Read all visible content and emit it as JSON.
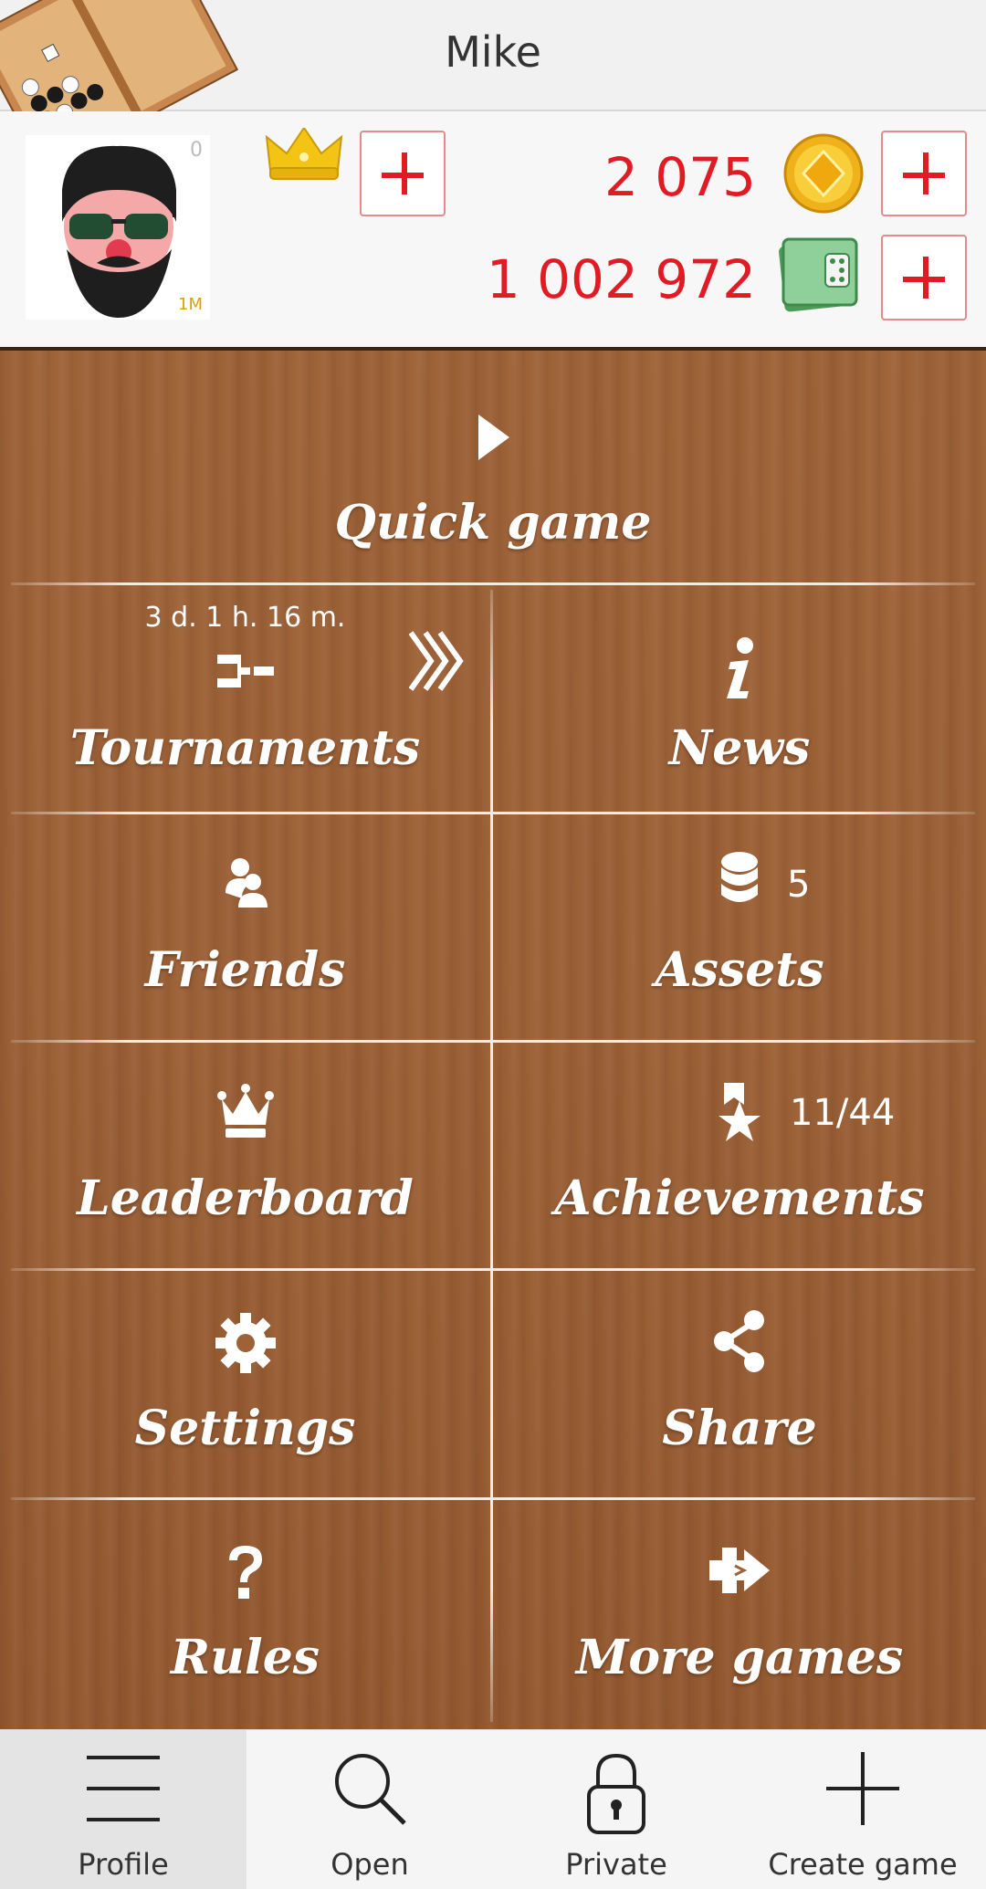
{
  "header": {
    "title": "Mike"
  },
  "profile": {
    "level": "0",
    "badge": "1M",
    "coins": "2 075",
    "cash": "1 002 972"
  },
  "menu": {
    "quick_game": "Quick game",
    "tournaments": {
      "label": "Tournaments",
      "timer": "3 d. 1 h. 16 m."
    },
    "news": "News",
    "friends": "Friends",
    "assets": {
      "label": "Assets",
      "count": "5"
    },
    "leaderboard": "Leaderboard",
    "achievements": {
      "label": "Achievements",
      "count": "11/44"
    },
    "settings": "Settings",
    "share": "Share",
    "rules": "Rules",
    "more_games": "More games"
  },
  "nav": [
    {
      "label": "Profile",
      "icon": "menu-icon",
      "active": true
    },
    {
      "label": "Open",
      "icon": "search-icon",
      "active": false
    },
    {
      "label": "Private",
      "icon": "lock-icon",
      "active": false
    },
    {
      "label": "Create game",
      "icon": "plus-icon",
      "active": false
    }
  ],
  "colors": {
    "accent": "#e01b24",
    "wood": "#9d6238",
    "bar": "#f1f1f2"
  }
}
